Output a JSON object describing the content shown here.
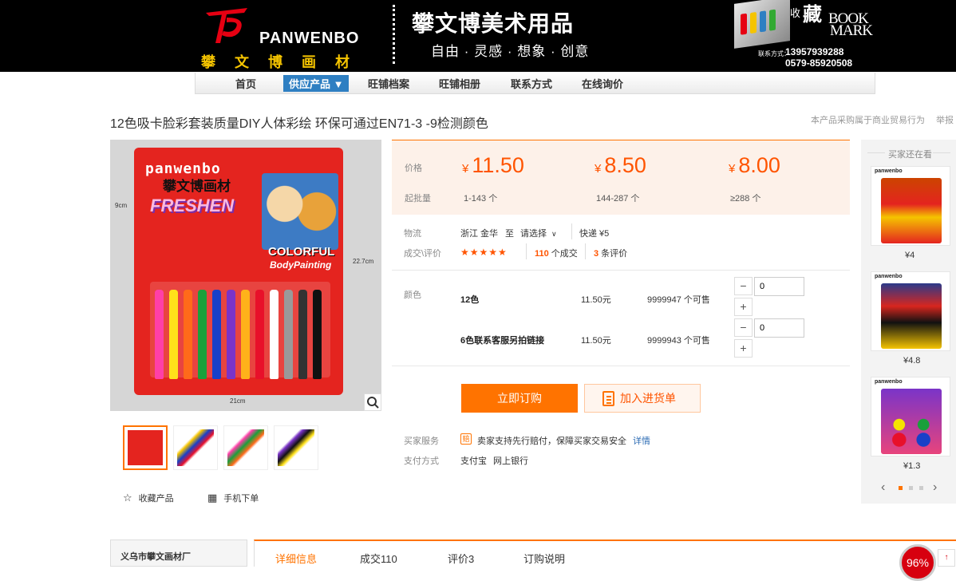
{
  "banner": {
    "logo_en": "PANWENBO",
    "logo_cn": "攀文博画材",
    "brand_name": "攀文博美术用品",
    "slogan": "自由 · 灵感 · 想象 · 创意",
    "promo_shou": "收",
    "promo_cang": "藏",
    "promo_bookmark_1": "BOOK",
    "promo_bookmark_2": "MARK",
    "contact_label": "联系方式：",
    "phone_1": "13957939288",
    "phone_2": "0579-85920508"
  },
  "nav": {
    "items": [
      {
        "label": "首页"
      },
      {
        "label": "供应产品 ▼"
      },
      {
        "label": "旺铺档案"
      },
      {
        "label": "旺铺相册"
      },
      {
        "label": "联系方式"
      },
      {
        "label": "在线询价"
      }
    ]
  },
  "product": {
    "title": "12色吸卡脸彩套装质量DIY人体彩绘 环保可通过EN71-3 -9检测颜色",
    "right_tip": "本产品采购属于商业贸易行为",
    "right_tip_2": "举报",
    "image": {
      "pack_brand": "panwenbo",
      "pack_cn": "攀文博画材",
      "pack_fresh": "FRESHEN",
      "pack_colorful": "COLORFUL",
      "pack_body": "BodyPainting",
      "dim_width": "21cm",
      "dim_height": "22.7cm",
      "dim_side": "9cm"
    },
    "favorite_label": "收藏产品",
    "mobile_label": "手机下单"
  },
  "pricing": {
    "price_label": "价格",
    "qty_label": "起批量",
    "currency": "¥",
    "tiers": [
      {
        "price": "11.50",
        "range": "1-143 个"
      },
      {
        "price": "8.50",
        "range": "144-287 个"
      },
      {
        "price": "8.00",
        "range": "≥288 个"
      }
    ]
  },
  "logistics": {
    "label": "物流",
    "from": "浙江 金华",
    "to": "至",
    "select": "请选择",
    "express": "快递 ¥5"
  },
  "deals": {
    "label": "成交\\评价",
    "stars": "★★★★★",
    "deal_count": "110",
    "deal_suffix": "个成交",
    "review_count": "3",
    "review_suffix": "条评价"
  },
  "skus": {
    "label": "颜色",
    "items": [
      {
        "name": "12色",
        "price": "11.50元",
        "stock": "9999947 个可售",
        "qty": "0"
      },
      {
        "name": "6色联系客服另拍链接",
        "price": "11.50元",
        "stock": "9999943 个可售",
        "qty": "0"
      }
    ]
  },
  "actions": {
    "buy": "立即订购",
    "cart": "加入进货单"
  },
  "service": {
    "label": "买家服务",
    "icon_text": "赔",
    "text": "卖家支持先行赔付，保障买家交易安全",
    "link": "详情",
    "pay_label": "支付方式",
    "pay_1": "支付宝",
    "pay_2": "网上银行"
  },
  "sidebar": {
    "title": "买家还在看",
    "items": [
      {
        "brand": "panwenbo",
        "price": "¥4"
      },
      {
        "brand": "panwenbo",
        "price": "¥4.8"
      },
      {
        "brand": "panwenbo",
        "price": "¥1.3"
      }
    ]
  },
  "bottom": {
    "shop_name": "义乌市攀文画材厂",
    "tabs": [
      {
        "label": "详细信息"
      },
      {
        "label": "成交110"
      },
      {
        "label": "评价3"
      },
      {
        "label": "订购说明"
      }
    ],
    "score": "96%",
    "top_arrow": "↑"
  },
  "colors": {
    "accent": "#ff7300",
    "price": "#ff5400",
    "nav_active": "#2e7fc2"
  }
}
